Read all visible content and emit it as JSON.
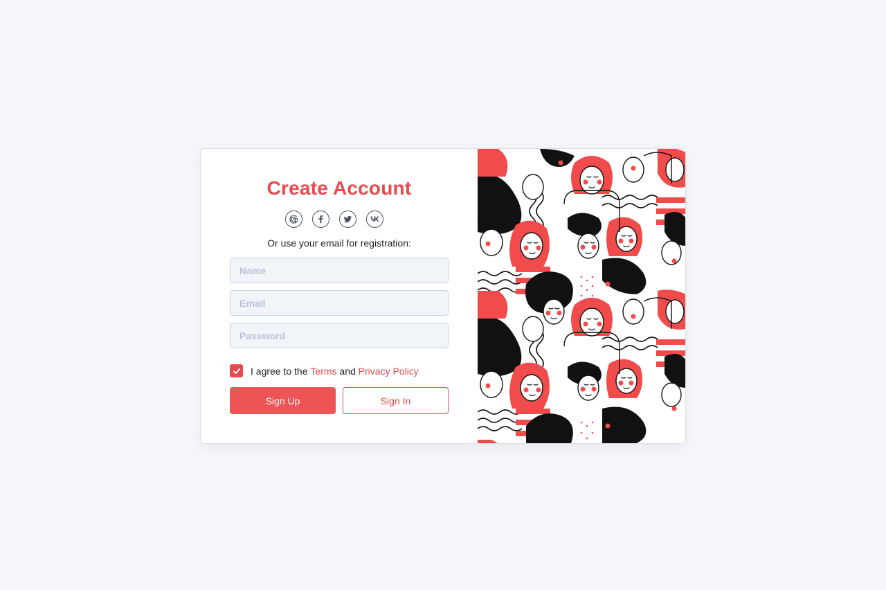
{
  "form": {
    "title": "Create Account",
    "subtext": "Or use your email for registration:",
    "name_placeholder": "Name",
    "email_placeholder": "Email",
    "password_placeholder": "Password",
    "agree_prefix": "I agree to the ",
    "terms_label": "Terms",
    "agree_and": " and ",
    "privacy_label": "Privacy Policy",
    "agree_checked": true,
    "signup_label": "Sign Up",
    "signin_label": "Sign In"
  },
  "socials": [
    {
      "icon": "google-icon"
    },
    {
      "icon": "facebook-icon"
    },
    {
      "icon": "twitter-icon"
    },
    {
      "icon": "vk-icon"
    }
  ],
  "colors": {
    "accent": "#e8494e",
    "background": "#f4f6fa",
    "field_bg": "#f1f4f8",
    "field_border": "#c9d5e3"
  },
  "illustration": {
    "icon": "people-crowd-illustration"
  }
}
